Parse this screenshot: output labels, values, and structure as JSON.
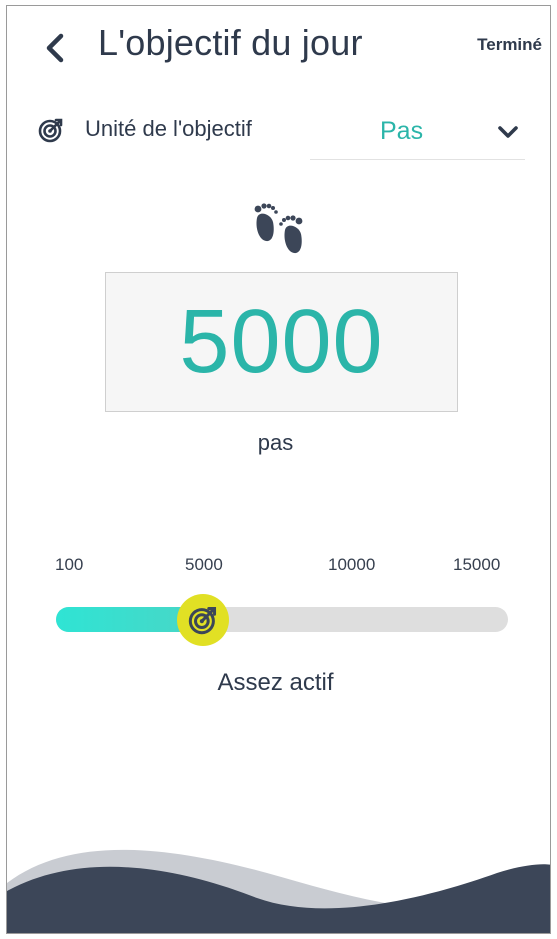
{
  "header": {
    "title": "L'objectif du jour",
    "done_label": "Terminé"
  },
  "unit": {
    "label": "Unité de l'objectif",
    "selected": "Pas"
  },
  "goal": {
    "value": "5000",
    "unit": "pas"
  },
  "slider": {
    "ticks": [
      "100",
      "5000",
      "10000",
      "15000"
    ],
    "min": 100,
    "max": 15000,
    "value": 5000,
    "level_label": "Assez actif"
  },
  "colors": {
    "accent": "#2bb5a9",
    "thumb": "#e1e024",
    "dark": "#2f3a4c",
    "wave": "#3c4658"
  },
  "icons": {
    "back": "chevron-left-icon",
    "unit": "target-icon",
    "dropdown": "chevron-down-icon",
    "feet": "footprints-icon",
    "thumb": "target-icon"
  }
}
